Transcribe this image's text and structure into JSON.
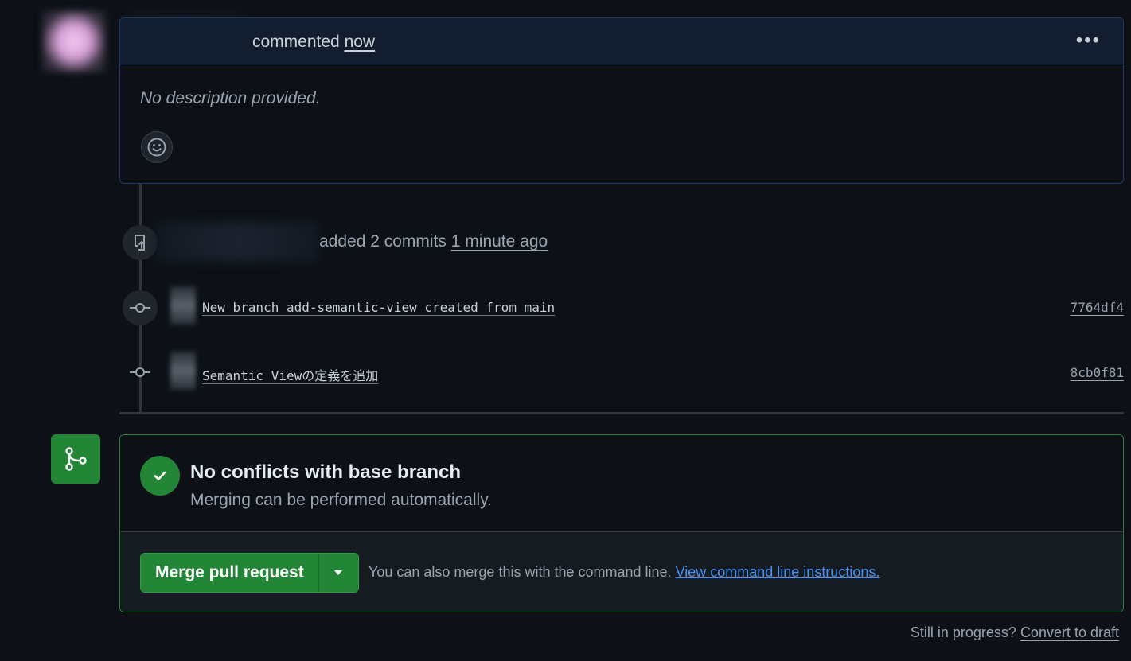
{
  "comment": {
    "action": "commented",
    "time": "now",
    "body": "No description provided."
  },
  "commit_event": {
    "action": "added 2 commits",
    "time": "1 minute ago"
  },
  "commits": [
    {
      "message": "New branch add-semantic-view created from main",
      "sha": "7764df4"
    },
    {
      "message": "Semantic Viewの定義を追加",
      "sha": "8cb0f81"
    }
  ],
  "merge": {
    "title": "No conflicts with base branch",
    "subtitle": "Merging can be performed automatically.",
    "button_label": "Merge pull request",
    "help_text": "You can also merge this with the command line.",
    "help_link": "View command line instructions."
  },
  "footer": {
    "text": "Still in progress?",
    "link": "Convert to draft"
  },
  "colors": {
    "background": "#0d1117",
    "accent_green": "#238636",
    "link_blue": "#4493f8"
  },
  "icons": [
    "kebab-icon",
    "smiley-icon",
    "repo-push-icon",
    "git-commit-icon",
    "git-merge-icon",
    "check-icon",
    "triangle-down-icon"
  ]
}
